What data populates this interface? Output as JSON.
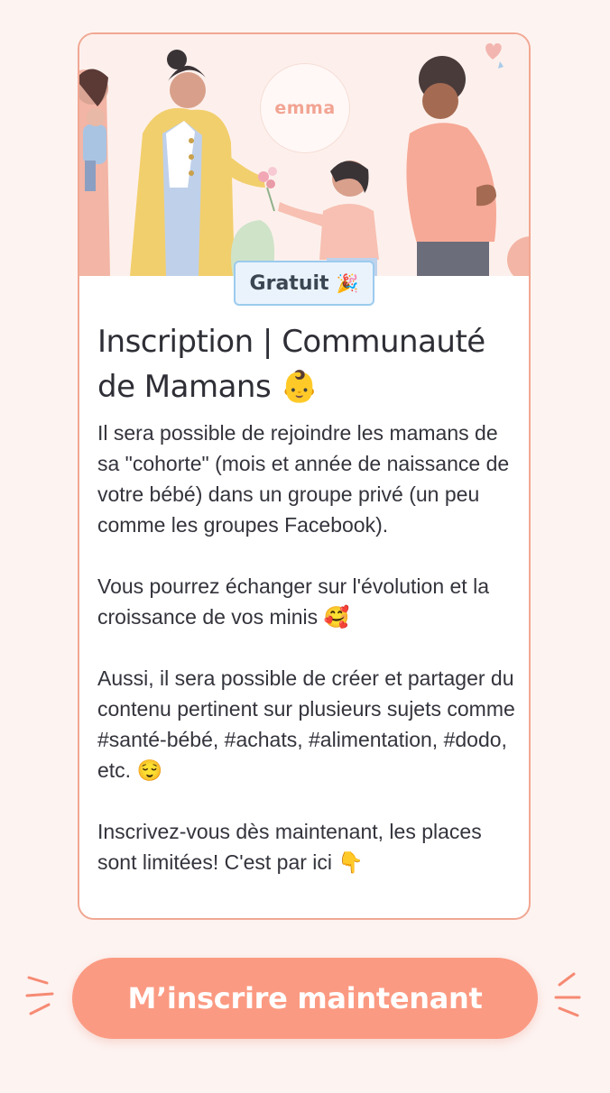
{
  "hero": {
    "logo_text": "emma",
    "icons": [
      "heart-icon"
    ]
  },
  "badge": {
    "label": "Gratuit",
    "emoji": "🎉"
  },
  "card": {
    "title_line1": "Inscription | Communauté",
    "title_line2": "de Mamans 👶",
    "paragraphs": [
      "Il sera possible de rejoindre les mamans de sa \"cohorte\" (mois et année de naissance de votre bébé) dans un groupe privé (un peu comme les groupes Facebook).",
      "Vous pourrez échanger sur l'évolution et la croissance de vos minis 🥰",
      "Aussi, il sera possible de créer et partager du contenu pertinent sur plusieurs sujets comme #santé-bébé, #achats, #alimentation, #dodo, etc. 😌",
      "Inscrivez-vous dès maintenant, les places sont limitées! C'est par ici 👇"
    ]
  },
  "cta": {
    "label": "M’inscrire maintenant"
  },
  "colors": {
    "accent": "#fb9a82",
    "card_border": "#f1a792",
    "badge_bg": "#eaf3fc",
    "badge_border": "#9ccbee",
    "background": "#fdf3f1"
  }
}
